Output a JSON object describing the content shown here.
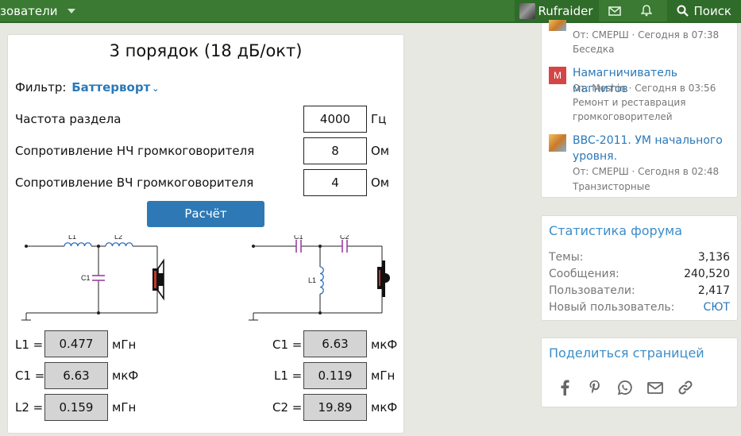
{
  "nav": {
    "users_label": "зователи",
    "username": "Rufraider",
    "search_label": "Поиск"
  },
  "calculator": {
    "title": "3 порядок (18 дБ/окт)",
    "filter_label": "Фильтр:",
    "filter_value": "Баттерворт",
    "fields": [
      {
        "label": "Частота раздела",
        "value": "4000",
        "unit": "Гц"
      },
      {
        "label": "Сопротивление НЧ громкоговорителя",
        "value": "8",
        "unit": "Ом"
      },
      {
        "label": "Сопротивление ВЧ громкоговорителя",
        "value": "4",
        "unit": "Ом"
      }
    ],
    "calc_button": "Расчёт",
    "lowpass_schematic": {
      "l1": "L1",
      "l2": "L2",
      "c1": "C1"
    },
    "highpass_schematic": {
      "c1": "C1",
      "c2": "C2",
      "l1": "L1"
    },
    "lowpass_results": [
      {
        "label": "L1 =",
        "value": "0.477",
        "unit": "мГн"
      },
      {
        "label": "C1 =",
        "value": "6.63",
        "unit": "мкФ"
      },
      {
        "label": "L2 =",
        "value": "0.159",
        "unit": "мГн"
      }
    ],
    "highpass_results": [
      {
        "label": "C1 =",
        "value": "6.63",
        "unit": "мкФ"
      },
      {
        "label": "L1 =",
        "value": "0.119",
        "unit": "мГн"
      },
      {
        "label": "C2 =",
        "value": "19.89",
        "unit": "мкФ"
      }
    ]
  },
  "sidebar": {
    "posts": [
      {
        "title": "",
        "meta1": "От: СМЕРШ · Сегодня в 07:38",
        "meta2": "Беседка",
        "meta3": ""
      },
      {
        "title": "Намагничиватель магнитов",
        "avatar_letter": "M",
        "avatar_color": "#d64545",
        "meta1": "От: Meshin · Сегодня в 03:56",
        "meta2": "Ремонт и реставрация",
        "meta3": "громкоговорителей"
      },
      {
        "title": "BBC-2011. УМ начального уровня.",
        "meta1": "От: СМЕРШ · Сегодня в 02:48",
        "meta2": "Транзисторные",
        "meta3": ""
      }
    ],
    "stats": {
      "heading": "Статистика форума",
      "rows": [
        {
          "label": "Темы:",
          "value": "3,136"
        },
        {
          "label": "Сообщения:",
          "value": "240,520"
        },
        {
          "label": "Пользователи:",
          "value": "2,417"
        },
        {
          "label": "Новый пользователь:",
          "value": "СЮТ"
        }
      ]
    },
    "share": {
      "heading": "Поделиться страницей",
      "icons": [
        "facebook-icon",
        "pinterest-icon",
        "whatsapp-icon",
        "email-icon",
        "link-icon"
      ]
    }
  },
  "colors": {
    "nav_green": "#3a7a32",
    "link_blue": "#2a78b8",
    "button_blue": "#2e79b5",
    "coil_blue": "#2f6fb8",
    "capacitor_purple": "#9b3fa6"
  }
}
